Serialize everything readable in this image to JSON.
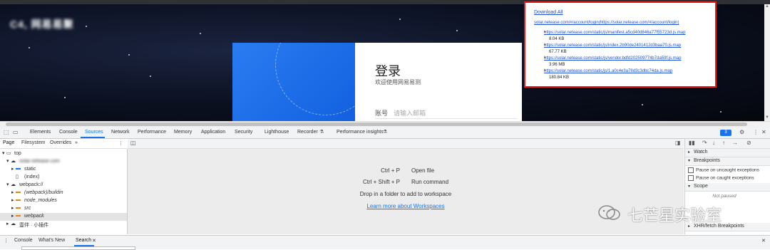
{
  "popup": {
    "download_all": "Download All",
    "page_url": "solar.netease.com/#/account/login(https://solar.netease.com/#/account/login)",
    "files": [
      {
        "url": "https://solar.netease.com/static/js/manifest.a5cd40d846a77f55723d.js.map",
        "size": "8.04 KB"
      },
      {
        "url": "https://solar.netease.com/static/js/index.2b90de2401412d3baa70.js.map",
        "size": "67.77 KB"
      },
      {
        "url": "https://solar.netease.com/static/js/vendor.bdfd202509774b7da59f.js.map",
        "size": "3.96 MB"
      },
      {
        "url": "https://solar.netease.com/static/js/1.a0c4e3a78d3c3dbc74da.js.map",
        "size": "180.84 KB"
      }
    ]
  },
  "page": {
    "logo": "C4, 网易易聚",
    "login_title": "登录",
    "login_subtitle": "欢迎使用网易易测",
    "account_label": "账号",
    "account_placeholder": "请输入邮箱"
  },
  "devtools": {
    "tabs": [
      "Elements",
      "Console",
      "Sources",
      "Network",
      "Performance",
      "Memory",
      "Application",
      "Security",
      "Lighthouse",
      "Recorder",
      "Performance insights"
    ],
    "active_tab": "Sources",
    "issues_count": "3",
    "nav_subtabs": [
      "Page",
      "Filesystem",
      "Overrides"
    ],
    "tree": [
      {
        "label": "top",
        "indent": 0,
        "type": "frame",
        "expanded": true
      },
      {
        "label": "solar.netease.com",
        "indent": 1,
        "type": "cloud",
        "expanded": true,
        "blurred": true
      },
      {
        "label": "static",
        "indent": 2,
        "type": "folder",
        "expanded": false
      },
      {
        "label": "(index)",
        "indent": 2,
        "type": "file"
      },
      {
        "label": "webpack://",
        "indent": 1,
        "type": "cloud",
        "expanded": true
      },
      {
        "label": "(webpack)/buildin",
        "indent": 2,
        "type": "folder-o",
        "expanded": false
      },
      {
        "label": "node_modules",
        "indent": 2,
        "type": "folder-o",
        "expanded": false
      },
      {
        "label": "src",
        "indent": 2,
        "type": "folder-o",
        "expanded": false
      },
      {
        "label": "webpack",
        "indent": 2,
        "type": "folder-o",
        "expanded": false,
        "selected": true
      },
      {
        "label": "壹伴 · 小插件",
        "indent": 1,
        "type": "cloud",
        "expanded": false
      }
    ],
    "editor": {
      "shortcuts": [
        {
          "key": "Ctrl + P",
          "action": "Open file"
        },
        {
          "key": "Ctrl + Shift + P",
          "action": "Run command"
        }
      ],
      "drop_text": "Drop in a folder to add to workspace",
      "learn_more": "Learn more about Workspaces"
    },
    "debugger": {
      "watch": "Watch",
      "breakpoints": "Breakpoints",
      "pause_uncaught": "Pause on uncaught exceptions",
      "pause_caught": "Pause on caught exceptions",
      "scope": "Scope",
      "not_paused": "Not paused",
      "xhr": "XHR/fetch Breakpoints"
    },
    "drawer_tabs": [
      "Console",
      "What's New",
      "Search"
    ],
    "drawer_active": "Search"
  },
  "watermark": "七芒星实验室"
}
